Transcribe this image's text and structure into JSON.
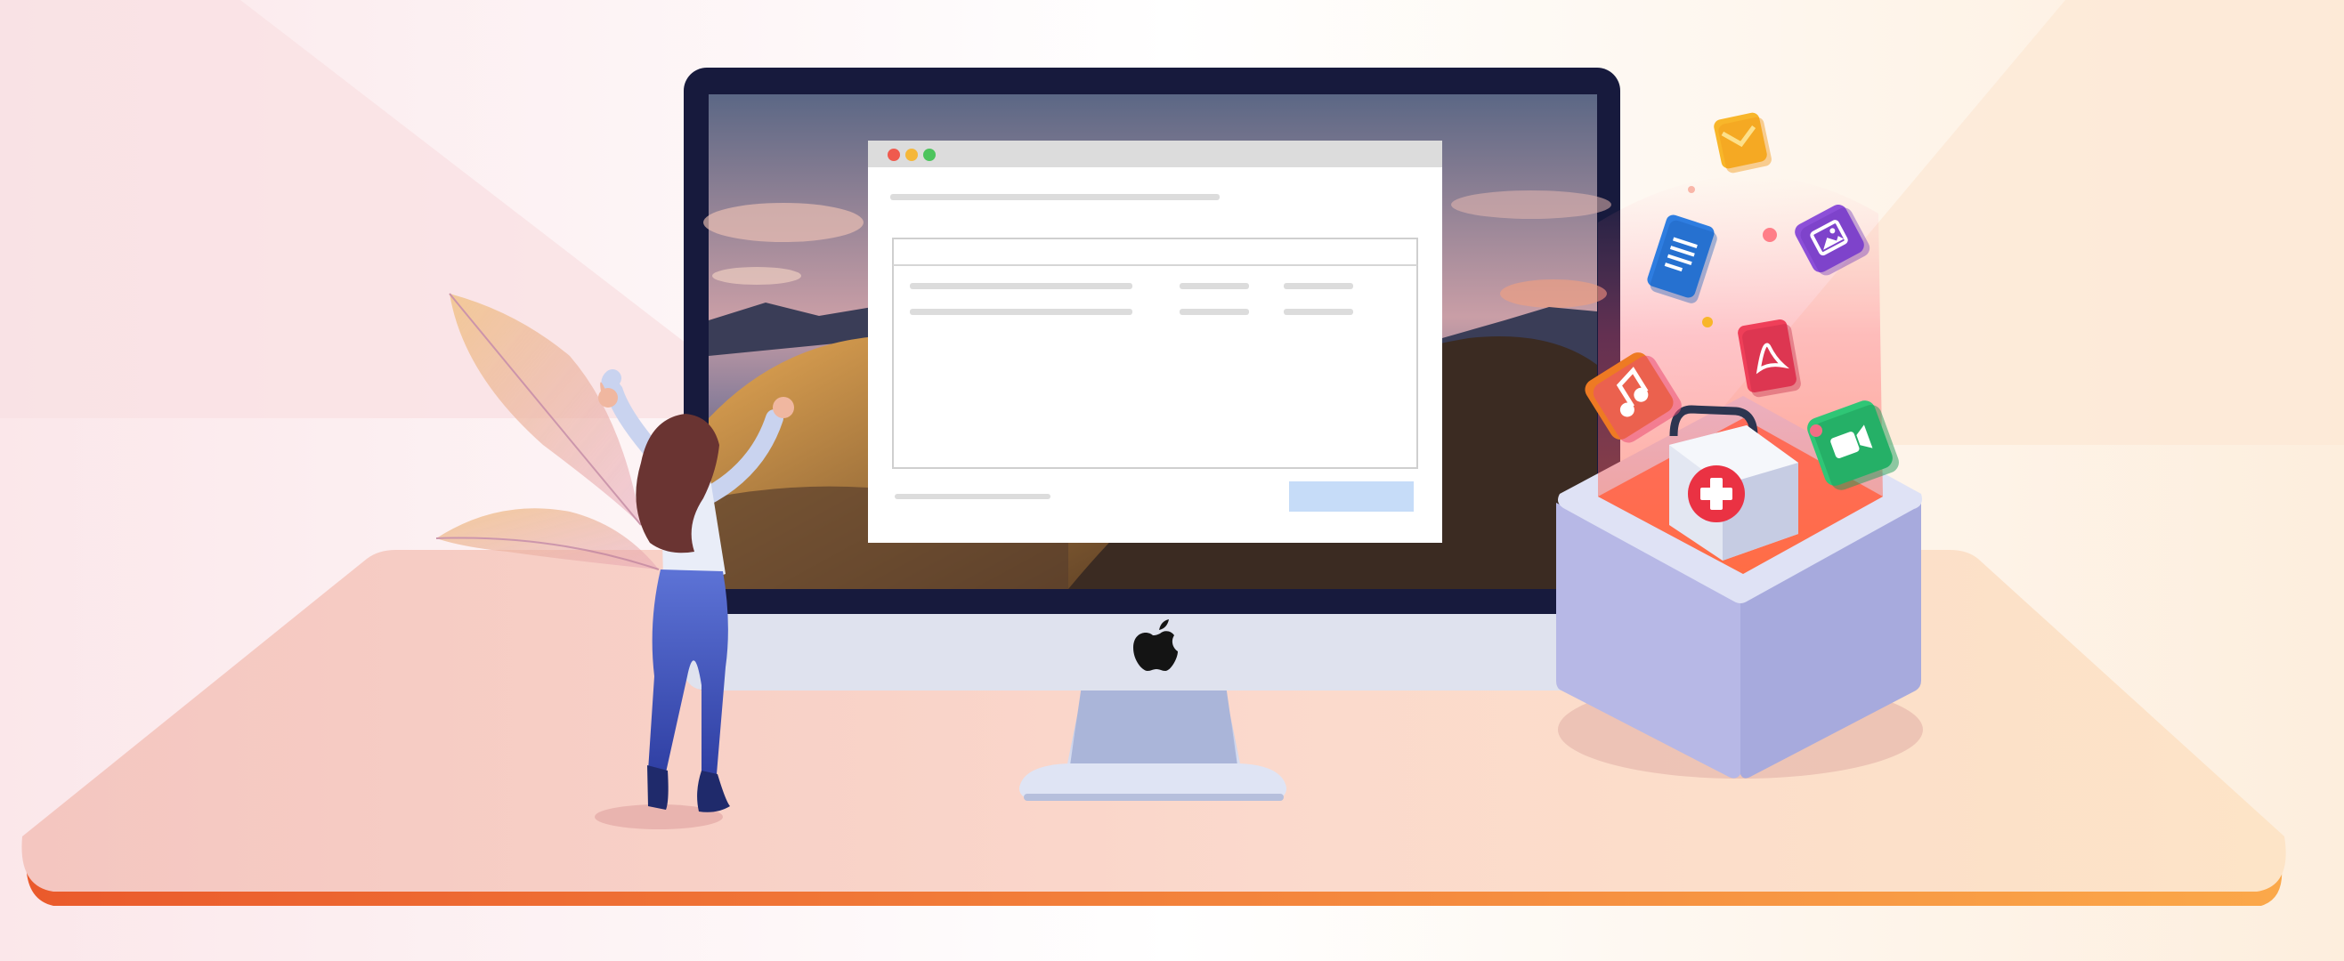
{
  "scene": {
    "description_free": true,
    "icons": [
      "mail-icon",
      "document-icon",
      "image-icon",
      "pdf-icon",
      "music-icon",
      "video-icon",
      "first-aid-kit-icon",
      "apple-logo-icon"
    ],
    "colors": {
      "stage_left": "#f3c3bd",
      "stage_right": "#fde3c6",
      "stage_edge_left": "#ec5d2c",
      "stage_edge_right": "#fba64a",
      "monitor_bezel": "#171a3d",
      "window_button": "#c6dcf8",
      "red_dot": "#ef5a4e",
      "yellow_dot": "#f5b739",
      "green_dot": "#4cc45d",
      "box_front": "#b9b9e4",
      "mail": "#f8b62a",
      "document": "#2e7de0",
      "image": "#8c4fd8",
      "pdf": "#ef3f59",
      "music": "#ee7a23",
      "video": "#2fc676"
    }
  }
}
